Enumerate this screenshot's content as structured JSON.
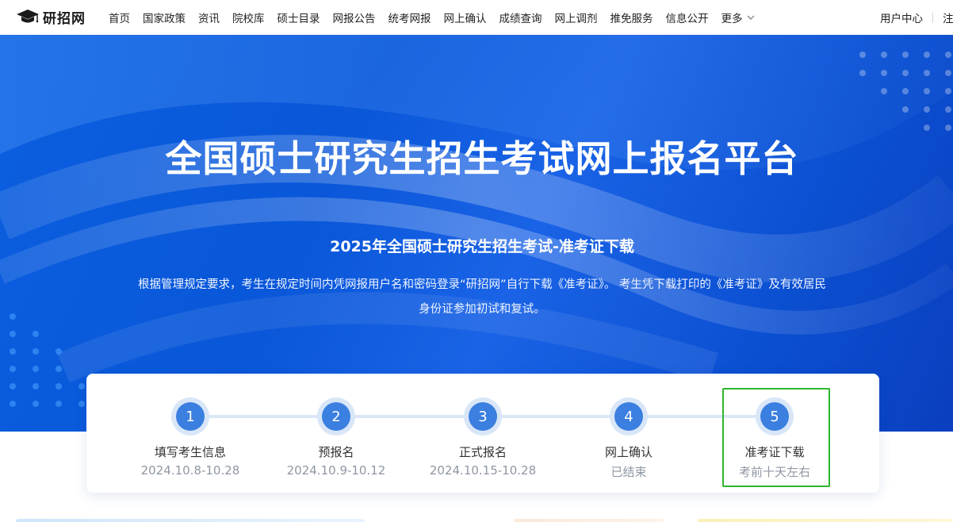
{
  "logo": {
    "text": "研招网",
    "icon": "graduation-cap-icon"
  },
  "nav": {
    "items": [
      "首页",
      "国家政策",
      "资讯",
      "院校库",
      "硕士目录",
      "网报公告",
      "统考网报",
      "网上确认",
      "成绩查询",
      "网上调剂",
      "推免服务",
      "信息公开"
    ],
    "more_label": "更多",
    "more_icon": "chevron-down-icon"
  },
  "user_links": {
    "center": "用户中心",
    "register": "注册"
  },
  "hero": {
    "title": "全国硕士研究生招生考试网上报名平台",
    "subtitle": "2025年全国硕士研究生招生考试-准考证下载",
    "description": "根据管理规定要求，考生在规定时间内凭网报用户名和密码登录“研招网”自行下载《准考证》。 考生凭下载打印的《准考证》及有效居民身份证参加初试和复试。"
  },
  "steps": [
    {
      "number": "1",
      "label": "填写考生信息",
      "date": "2024.10.8-10.28"
    },
    {
      "number": "2",
      "label": "预报名",
      "date": "2024.10.9-10.12"
    },
    {
      "number": "3",
      "label": "正式报名",
      "date": "2024.10.15-10.28"
    },
    {
      "number": "4",
      "label": "网上确认",
      "date": "已结束"
    },
    {
      "number": "5",
      "label": "准考证下载",
      "date": "考前十天左右"
    }
  ],
  "colors": {
    "hero_blue": "#0b5fe0",
    "step_circle": "#3b7fe0",
    "step_halo": "#d8e6f8",
    "highlight_green": "#2db52d"
  }
}
